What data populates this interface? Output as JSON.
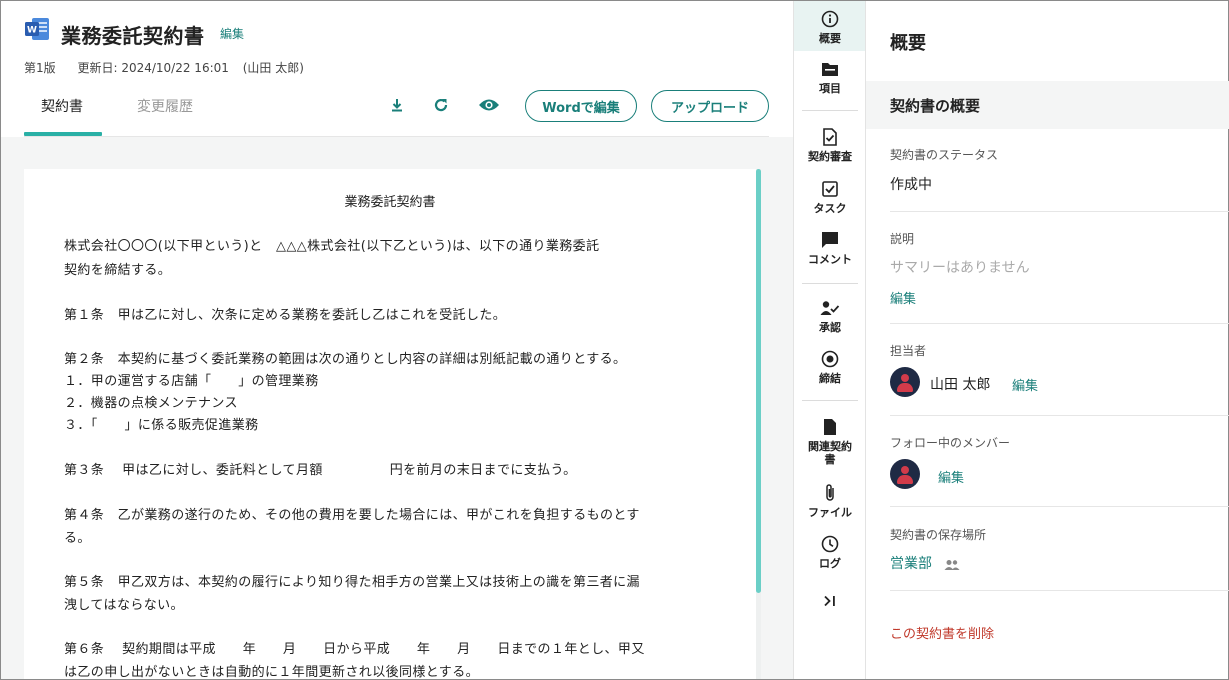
{
  "document": {
    "title": "業務委託契約書",
    "title_edit": "編集",
    "version": "第1版",
    "updated": "更新日: 2024/10/22 16:01",
    "updated_by": "(山田 太郎)"
  },
  "tabs": {
    "contract": "契約書",
    "history": "変更履歴"
  },
  "toolbar": {
    "word_edit": "Wordで編集",
    "upload": "アップロード"
  },
  "icons": {
    "word": "word-file-icon",
    "download": "download-icon",
    "refresh": "refresh-icon",
    "preview": "eye-icon"
  },
  "doc_body": {
    "heading": "業務委託契約書",
    "lines": [
      "株式会社〇〇〇(以下甲という)と　△△△株式会社(以下乙という)は、以下の通り業務委託",
      "契約を締結する。",
      "第１条　甲は乙に対し、次条に定める業務を委託し乙はこれを受託した。",
      "第２条　本契約に基づく委託業務の範囲は次の通りとし内容の詳細は別紙記載の通りとする。",
      "１．甲の運営する店舗「　　」の管理業務",
      "２．機器の点検メンテナンス",
      "３．「　　」に係る販売促進業務",
      "第３条　 甲は乙に対し、委託料として月額　　　　　円を前月の末日までに支払う。",
      "第４条　乙が業務の遂行のため、その他の費用を要した場合には、甲がこれを負担するものとす",
      "る。",
      "第５条　甲乙双方は、本契約の履行により知り得た相手方の営業上又は技術上の識を第三者に漏",
      "洩してはならない。",
      "第６条　 契約期間は平成　　年　　月　　日から平成　　年　　月　　日までの１年とし、甲又",
      "は乙の申し出がないときは自動的に１年間更新され以後同様とする。"
    ]
  },
  "rail": [
    {
      "label": "概要",
      "icon": "info-icon"
    },
    {
      "label": "項目",
      "icon": "folder-icon"
    },
    {
      "label": "契約審査",
      "icon": "review-doc-icon"
    },
    {
      "label": "タスク",
      "icon": "checkbox-icon"
    },
    {
      "label": "コメント",
      "icon": "comment-icon"
    },
    {
      "label": "承認",
      "icon": "user-check-icon"
    },
    {
      "label": "締結",
      "icon": "target-icon"
    },
    {
      "label": "関連契約書",
      "icon": "related-doc-icon"
    },
    {
      "label": "ファイル",
      "icon": "paperclip-icon"
    },
    {
      "label": "ログ",
      "icon": "clock-icon"
    },
    {
      "label": "",
      "icon": "collapse-panel-icon"
    }
  ],
  "panel": {
    "title": "概要",
    "section_title": "契約書の概要",
    "status_label": "契約書のステータス",
    "status_value": "作成中",
    "description_label": "説明",
    "description_value": "サマリーはありません",
    "description_edit": "編集",
    "assignee_label": "担当者",
    "assignee_name": "山田 太郎",
    "assignee_edit": "編集",
    "followers_label": "フォロー中のメンバー",
    "followers_edit": "編集",
    "storage_label": "契約書の保存場所",
    "storage_value": "営業部",
    "delete": "この契約書を削除"
  },
  "colors": {
    "accent": "#1a7f7a",
    "accent_light": "#2ab0a6",
    "danger": "#c0392b",
    "avatar_bg": "#1f2a44",
    "avatar_fg": "#d23b4a"
  }
}
